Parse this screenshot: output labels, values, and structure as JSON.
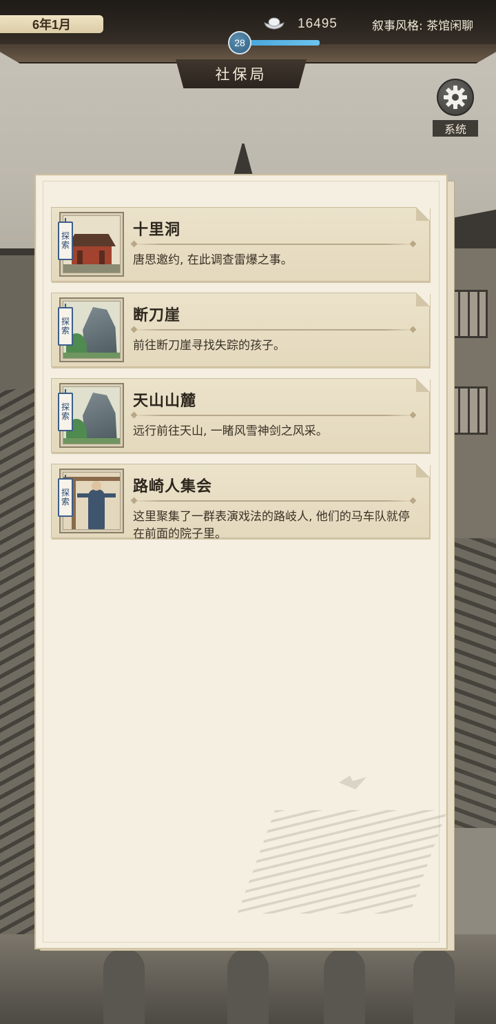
{
  "topbar": {
    "date": "6年1月",
    "silver_icon": "silver-ingot-icon",
    "silver_amount": "16495",
    "narrative_style": "叙事风格: 茶馆闲聊",
    "level": "28",
    "xp_progress_percent": 100
  },
  "location": {
    "name": "社保局"
  },
  "system": {
    "icon": "gear-icon",
    "label": "系统"
  },
  "quests": [
    {
      "tag_chars": [
        "探",
        "索"
      ],
      "title": "十里洞",
      "description": "唐思邀约, 在此调查雷爆之事。",
      "thumbnail": "palace"
    },
    {
      "tag_chars": [
        "探",
        "索"
      ],
      "title": "断刀崖",
      "description": "前往断刀崖寻找失踪的孩子。",
      "thumbnail": "rock"
    },
    {
      "tag_chars": [
        "探",
        "索"
      ],
      "title": "天山山麓",
      "description": "远行前往天山, 一睹风雪神剑之风采。",
      "thumbnail": "rock"
    },
    {
      "tag_chars": [
        "探",
        "索"
      ],
      "title": "路崎人集会",
      "description": "这里聚集了一群表演戏法的路岐人, 他们的马车队就停在前面的院子里。",
      "thumbnail": "crowd"
    }
  ]
}
